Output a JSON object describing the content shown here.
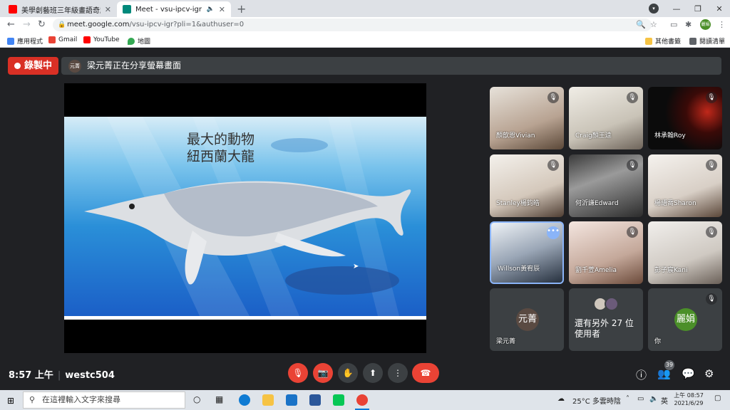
{
  "browser": {
    "tabs": [
      {
        "title": "美學創藝班三年級畫語奇趣線上#",
        "favicon_color": "#ff0000",
        "active": false
      },
      {
        "title": "Meet - vsu-ipcv-igr",
        "favicon_color": "#00897b",
        "active": true
      }
    ],
    "url_domain": "meet.google.com",
    "url_path": "/vsu-ipcv-igr?pli=1&authuser=0",
    "profile_avatar_text": "麗娟",
    "bookmarks": [
      {
        "label": "應用程式",
        "icon": "apps-grid-icon",
        "color": "#4285f4"
      },
      {
        "label": "Gmail",
        "icon": "gmail-icon",
        "color": "#ea4335"
      },
      {
        "label": "YouTube",
        "icon": "youtube-icon",
        "color": "#ff0000"
      },
      {
        "label": "地圖",
        "icon": "maps-icon",
        "color": "#34a853"
      }
    ],
    "bookmarks_right": [
      {
        "label": "其他書籤",
        "icon": "folder-icon",
        "color": "#f6c344"
      },
      {
        "label": "閱讀清單",
        "icon": "reading-list-icon",
        "color": "#5f6368"
      }
    ]
  },
  "meet": {
    "recording_label": "錄製中",
    "presenter_initials": "元菁",
    "sharing_banner": "梁元菁正在分享螢幕畫面",
    "slide_title": "最大的動物\n紐西蘭大龍",
    "tiles": [
      {
        "name": "顏歆恩Vivian",
        "muted": true,
        "bg": "bg1"
      },
      {
        "name": "Craig顏王逵",
        "muted": true,
        "bg": "bg2"
      },
      {
        "name": "林承翰Roy",
        "muted": true,
        "bg": "bg3"
      },
      {
        "name": "Stanley楊鈞皓",
        "muted": true,
        "bg": "bg4"
      },
      {
        "name": "何沂謙Edward",
        "muted": true,
        "bg": "bg5"
      },
      {
        "name": "楊語喬Sharon",
        "muted": true,
        "bg": "bg6"
      },
      {
        "name": "Willson黃宥辰",
        "muted": false,
        "bg": "bg7",
        "focused": true
      },
      {
        "name": "劉千萱Amelia",
        "muted": true,
        "bg": "bg8"
      },
      {
        "name": "彭子宸Kani",
        "muted": true,
        "bg": "bg9"
      }
    ],
    "bottom_tiles": [
      {
        "name": "梁元菁",
        "avatar": "元菁",
        "avatar_color": "#5a4a42"
      },
      {
        "more_text": "還有另外 27 位使用者"
      },
      {
        "name": "你",
        "avatar": "麗娟",
        "avatar_color": "#4b8f29",
        "muted": true
      }
    ],
    "clock": "8:57 上午",
    "meeting_code": "westc504",
    "participant_count": "39"
  },
  "taskbar": {
    "search_placeholder": "在這裡輸入文字來搜尋",
    "weather": "25°C 多雲時陰",
    "ime": "英",
    "time": "上午 08:57",
    "date": "2021/6/29"
  }
}
